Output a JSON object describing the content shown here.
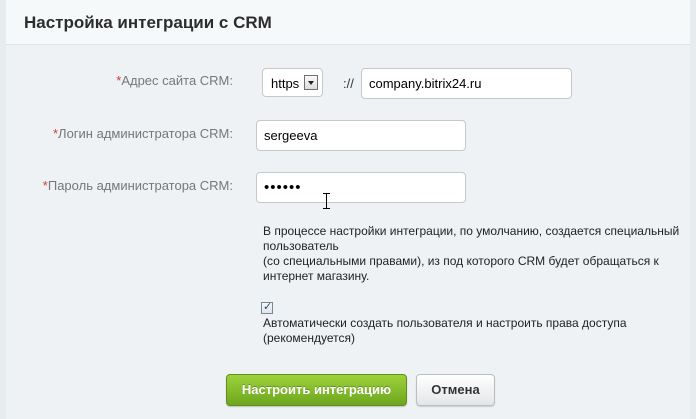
{
  "panel": {
    "title": "Настройка интеграции с CRM"
  },
  "form": {
    "site": {
      "required_mark": "*",
      "label": "Адрес сайта CRM:",
      "protocol": "https",
      "separator": "://",
      "value": "company.bitrix24.ru"
    },
    "login": {
      "required_mark": "*",
      "label": "Логин администратора CRM:",
      "value": "sergeeva"
    },
    "password": {
      "required_mark": "*",
      "label": "Пароль администратора CRM:",
      "value": "••••••"
    },
    "info": {
      "line1": "В процессе настройки интеграции, по умолчанию, создается специальный пользователь",
      "line2": "(со специальными правами), из под которого CRM будет обращаться к интернет магазину."
    },
    "auto_create": {
      "checked": true,
      "line1": "Автоматически создать пользователя и настроить права доступа",
      "line2": "(рекомендуется)"
    }
  },
  "buttons": {
    "submit": "Настроить интеграцию",
    "cancel": "Отмена"
  },
  "colors": {
    "primary_button": "#7cb82f",
    "required_mark": "#d23b3b",
    "label": "#777777"
  }
}
